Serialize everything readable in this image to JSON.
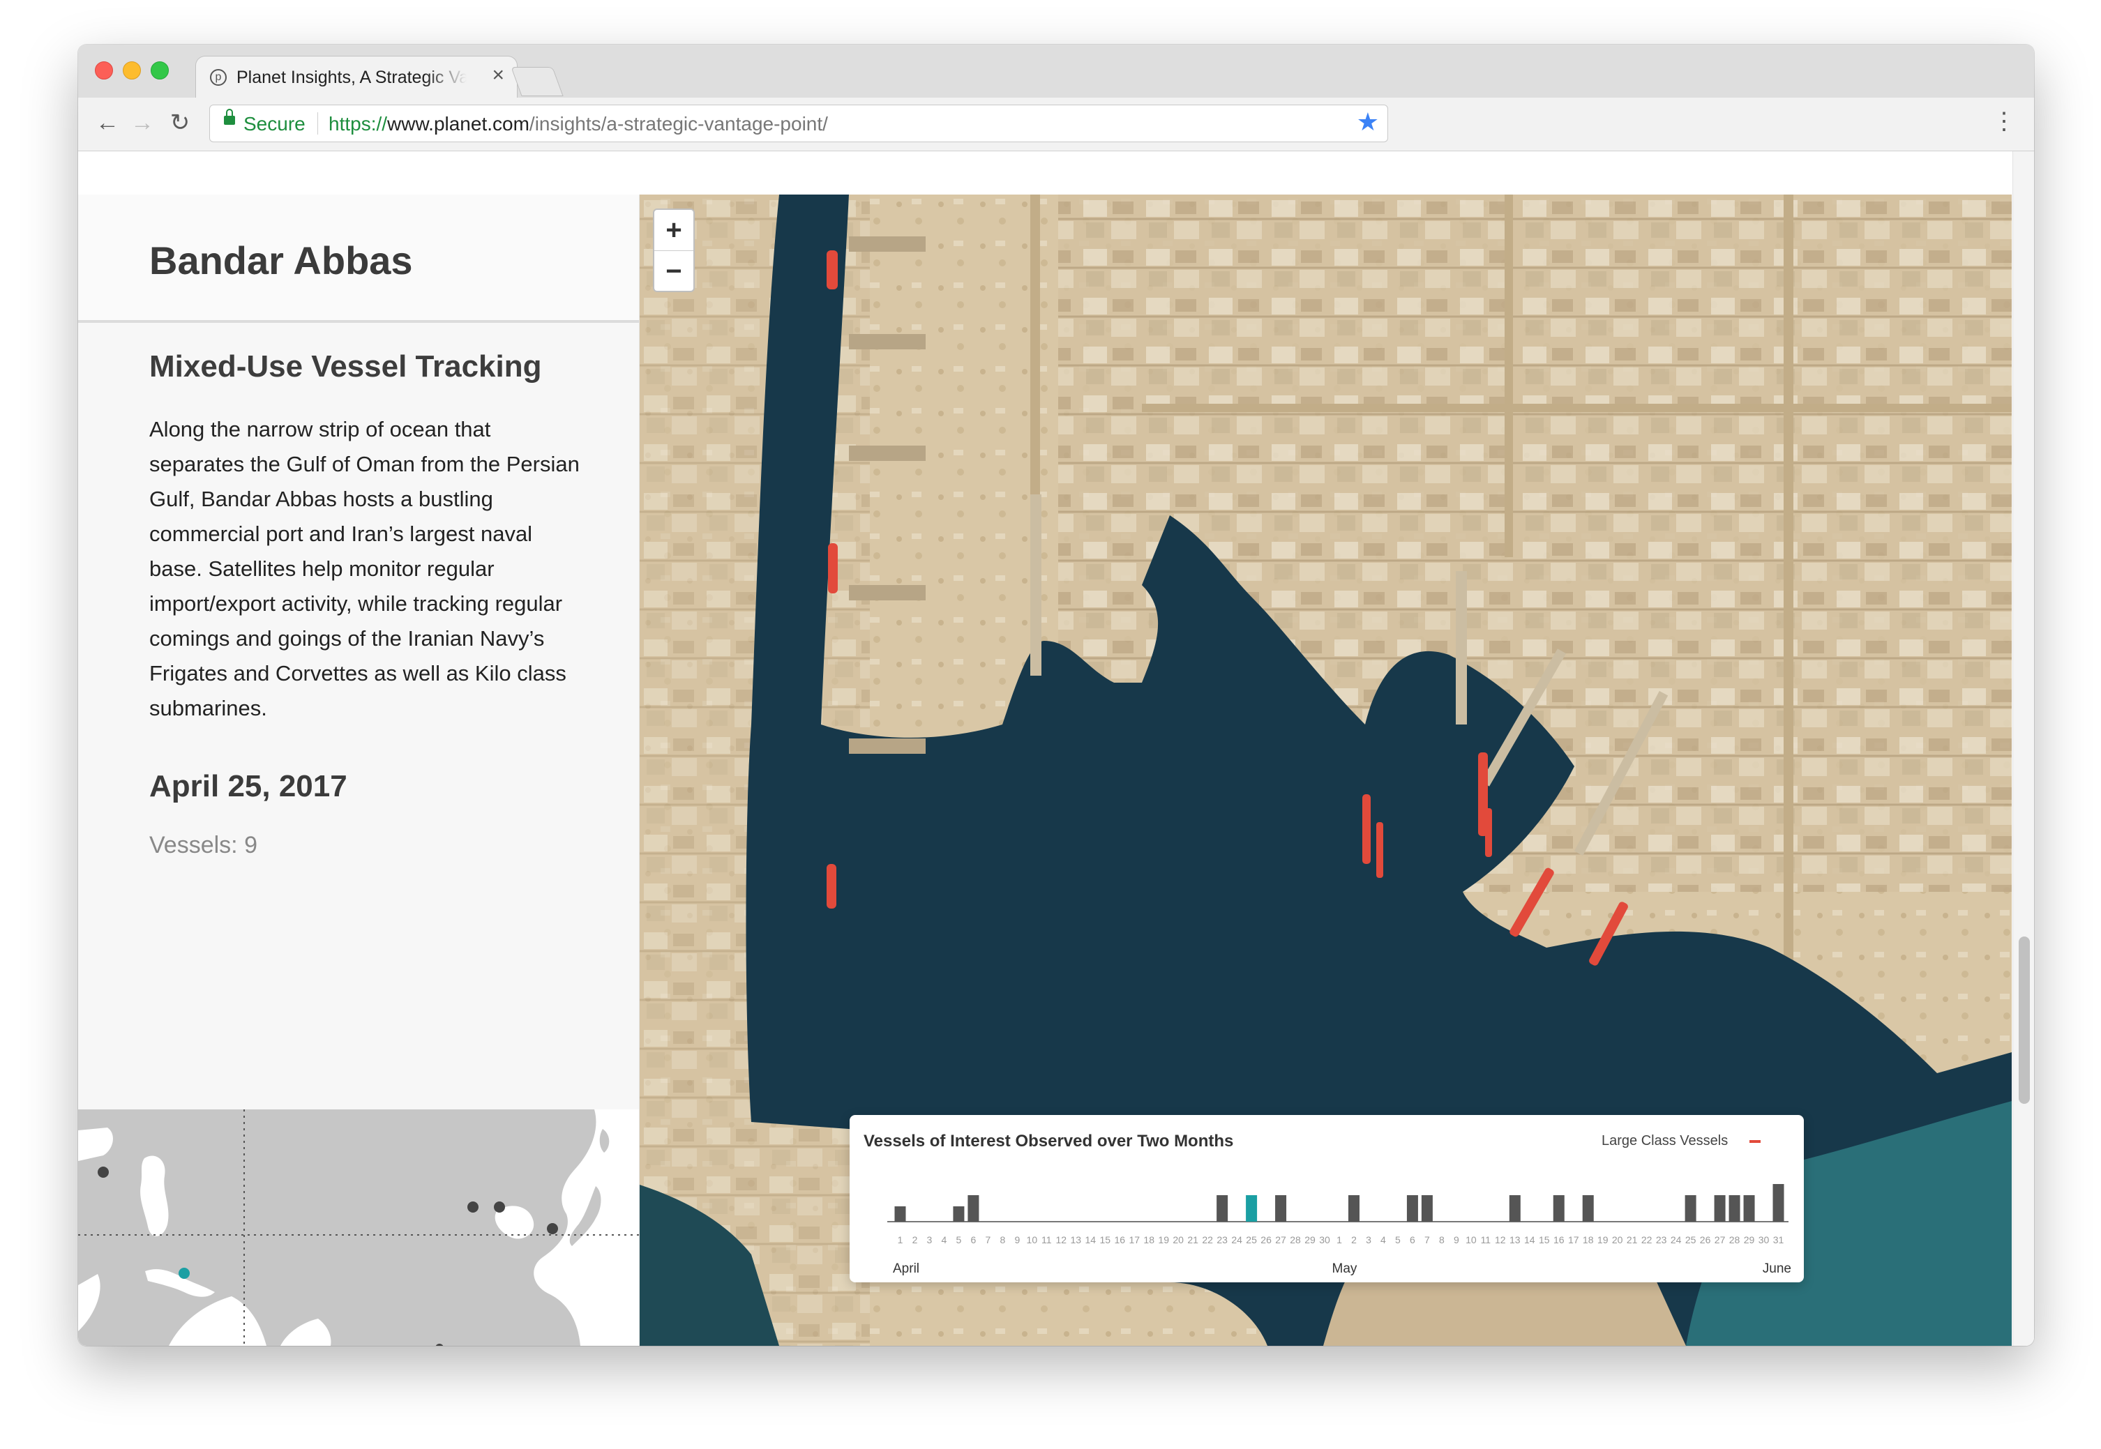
{
  "browser": {
    "tab_title": "Planet Insights, A Strategic Vantage Point",
    "tab_favicon": "p",
    "tab_close": "×",
    "nav_back": "←",
    "nav_forward": "→",
    "nav_reload": "↻",
    "secure_label": "Secure",
    "url_protocol": "https://",
    "url_host": "www.planet.com",
    "url_path": "/insights/a-strategic-vantage-point/",
    "bookmark_star": "★",
    "menu_icon": "⋮"
  },
  "sidebar": {
    "place_title": "Bandar Abbas",
    "section_title": "Mixed-Use Vessel Tracking",
    "body": "Along the narrow strip of ocean that separates the Gulf of Oman from the Persian Gulf, Bandar Abbas hosts a bustling commercial port and Iran’s largest naval base. Satellites help monitor regular import/export activity, while tracking regular comings and goings of the Iranian Navy’s Frigates and Corvettes as well as Kilo class submarines.",
    "date": "April 25, 2017",
    "vessels": "Vessels: 9"
  },
  "map": {
    "zoom_in": "+",
    "zoom_out": "−"
  },
  "chart": {
    "title": "Vessels of Interest Observed over Two Months",
    "legend": "Large Class Vessels",
    "legend_color": "#e24a3b",
    "bar_color": "#555555",
    "highlight_color": "#1b9fa3",
    "month_labels": [
      "April",
      "May",
      "June"
    ]
  },
  "chart_data": {
    "type": "bar",
    "title": "Vessels of Interest Observed over Two Months",
    "legend": [
      "Large Class Vessels"
    ],
    "categories": [
      "1",
      "2",
      "3",
      "4",
      "5",
      "6",
      "7",
      "8",
      "9",
      "10",
      "11",
      "12",
      "13",
      "14",
      "15",
      "16",
      "17",
      "18",
      "19",
      "20",
      "21",
      "22",
      "23",
      "24",
      "25",
      "26",
      "27",
      "28",
      "29",
      "30",
      "1",
      "2",
      "3",
      "4",
      "5",
      "6",
      "7",
      "8",
      "9",
      "10",
      "11",
      "12",
      "13",
      "14",
      "15",
      "16",
      "17",
      "18",
      "19",
      "20",
      "21",
      "22",
      "23",
      "24",
      "25",
      "26",
      "27",
      "28",
      "29",
      "30",
      "31"
    ],
    "values": [
      1,
      0,
      0,
      0,
      1,
      2,
      0,
      0,
      0,
      0,
      0,
      0,
      0,
      0,
      0,
      0,
      0,
      0,
      0,
      0,
      0,
      0,
      2,
      0,
      2,
      0,
      2,
      0,
      0,
      0,
      0,
      2,
      0,
      0,
      0,
      2,
      2,
      0,
      0,
      0,
      0,
      0,
      2,
      0,
      0,
      2,
      0,
      2,
      0,
      0,
      0,
      0,
      0,
      0,
      2,
      0,
      2,
      2,
      2,
      0,
      3
    ],
    "highlighted": "April 25",
    "months": [
      "April",
      "May",
      "June"
    ]
  },
  "minimap": {
    "land_color": "#c6c6c6",
    "dot_color": "#444444",
    "current_dot_color": "#1b9fa3"
  }
}
